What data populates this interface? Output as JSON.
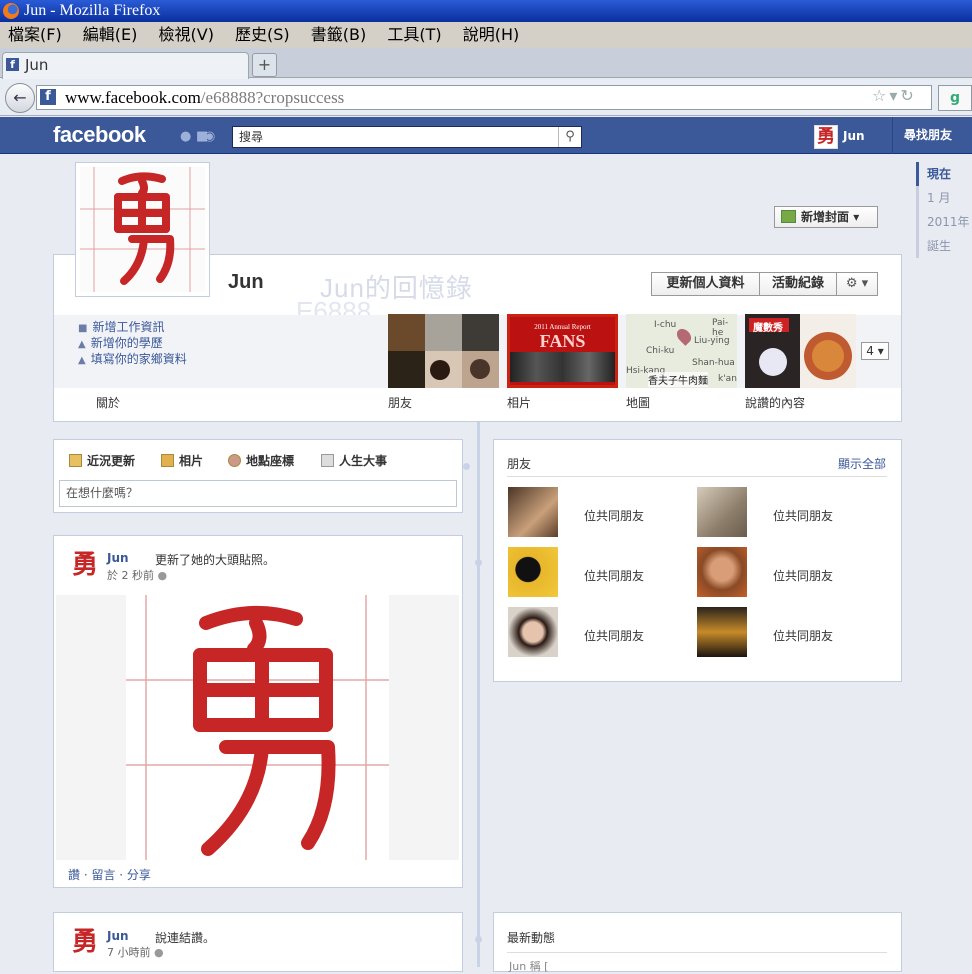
{
  "window": {
    "title": "Jun - Mozilla Firefox",
    "title_name": "Jun",
    "title_app": "- Mozilla Firefox"
  },
  "menu": [
    "檔案(F)",
    "編輯(E)",
    "檢視(V)",
    "歷史(S)",
    "書籤(B)",
    "工具(T)",
    "說明(H)"
  ],
  "tab": {
    "label": "Jun",
    "new_tab": "+"
  },
  "nav": {
    "url_domain": "www.facebook.com",
    "url_path": "/e68888?cropsuccess"
  },
  "fb": {
    "logo": "facebook",
    "search_placeholder": "搜尋",
    "user": "Jun",
    "find_friends": "尋找朋友"
  },
  "timeline_nav": [
    "現在",
    "1 月",
    "2011年",
    "誕生"
  ],
  "profile": {
    "name": "Jun",
    "add_cover": "新增封面",
    "update_info": "更新個人資料",
    "activity_log": "活動紀錄",
    "watermark_1": "Jun的回憶錄",
    "watermark_2": "E6888",
    "info_links": [
      "新增工作資訊",
      "新增你的學歷",
      "填寫你的家鄉資料"
    ],
    "sections": [
      "關於",
      "朋友",
      "相片",
      "地圖",
      "說讚的內容"
    ],
    "more_count": "4",
    "photos_thumb_title": "2011 Annual Report",
    "photos_thumb_text": "FANS",
    "map_labels": [
      "I-chu",
      "Pai-he",
      "Chi-ku",
      "Liu-ying",
      "Shan-hua",
      "Hsi-kang",
      "k'an"
    ],
    "map_caption": "香夫子牛肉麵",
    "likes_thumb_text": "魔數秀"
  },
  "composer": {
    "tabs": [
      "近況更新",
      "相片",
      "地點座標",
      "人生大事"
    ],
    "placeholder": "在想什麼嗎？"
  },
  "story1": {
    "name": "Jun",
    "verb": "更新了她的大頭貼照。",
    "time": "於 2 秒前",
    "actions": "讚 · 留言 · 分享"
  },
  "friends": {
    "title": "朋友",
    "show_all": "顯示全部",
    "items": [
      "位共同朋友",
      "位共同朋友",
      "位共同朋友",
      "位共同朋友",
      "位共同朋友",
      "位共同朋友"
    ]
  },
  "story2": {
    "name": "Jun",
    "verb": "說連結讚。",
    "time": "7 小時前"
  },
  "recent": {
    "title": "最新動態",
    "snippet": "Jun 稱 ["
  },
  "colors": {
    "fb_blue": "#3b5998",
    "seal_red": "#c62626"
  },
  "avatar_glyph": "勇"
}
